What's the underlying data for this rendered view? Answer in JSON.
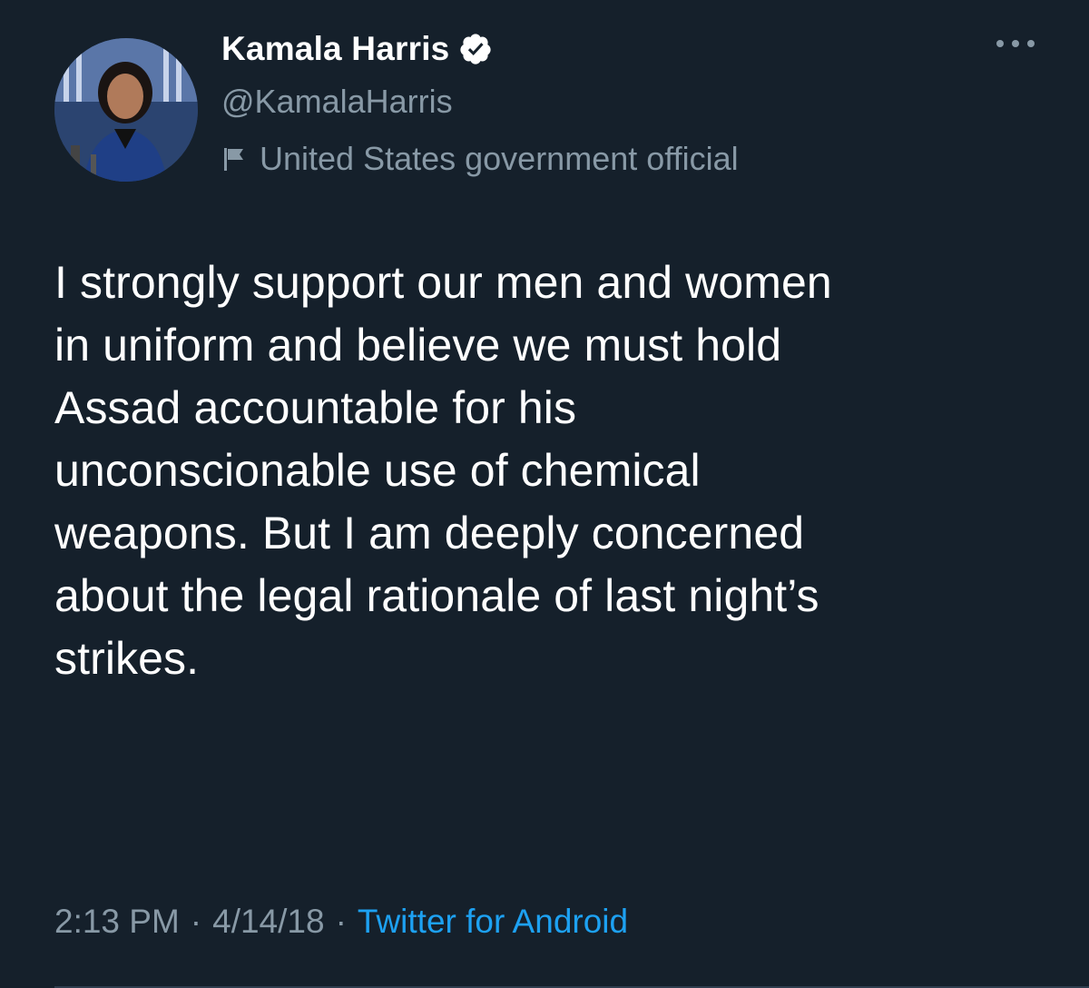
{
  "author": {
    "display_name": "Kamala Harris",
    "handle": "@KamalaHarris",
    "label": "United States government official",
    "verified": true,
    "verified_icon": "verified-badge-icon",
    "label_icon": "flag-icon"
  },
  "tweet": {
    "text": "I strongly support our men and women\nin uniform and believe we must hold\nAssad accountable for his\nunconscionable use of chemical\nweapons. But I am deeply concerned\nabout the legal rationale of last night’s\nstrikes.",
    "time": "2:13 PM",
    "date": "4/14/18",
    "source": "Twitter for Android",
    "separator": "·"
  },
  "actions": {
    "more_icon": "more-options-icon"
  },
  "colors": {
    "background": "#15202b",
    "secondary_text": "#8899a6",
    "accent": "#1da1f2"
  }
}
